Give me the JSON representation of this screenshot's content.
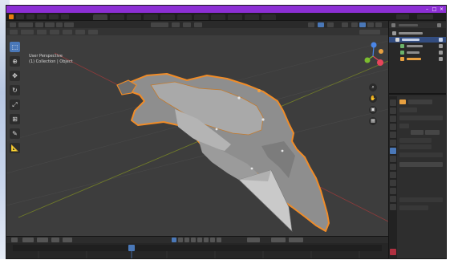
{
  "window": {
    "title": "",
    "controls": [
      "minimize-icon",
      "maximize-icon",
      "close-icon"
    ]
  },
  "menubar": {
    "menus": [
      "",
      "",
      "",
      "",
      "",
      ""
    ],
    "workspace_tabs": [
      "",
      "",
      "",
      "",
      "",
      "",
      "",
      "",
      "",
      "",
      ""
    ]
  },
  "viewport": {
    "overlay_line1": "User Perspective",
    "overlay_line2": "(1) Collection | Object",
    "tools": [
      "cursor-select-icon",
      "move-icon",
      "rotate-icon",
      "scale-icon",
      "transform-icon",
      "annotate-icon",
      "measure-icon"
    ],
    "gizmo_axis_colors": {
      "x": "#e8455a",
      "y": "#7cbd2f",
      "z": "#4a86e8"
    }
  },
  "timeline": {
    "current_frame_marker": 1
  },
  "colors": {
    "titlebar": "#8c2fd4",
    "selection": "#4a78b8",
    "selected_outline": "#f08c28",
    "mesh": "#8e8e8e",
    "background": "#3d3d3d"
  }
}
